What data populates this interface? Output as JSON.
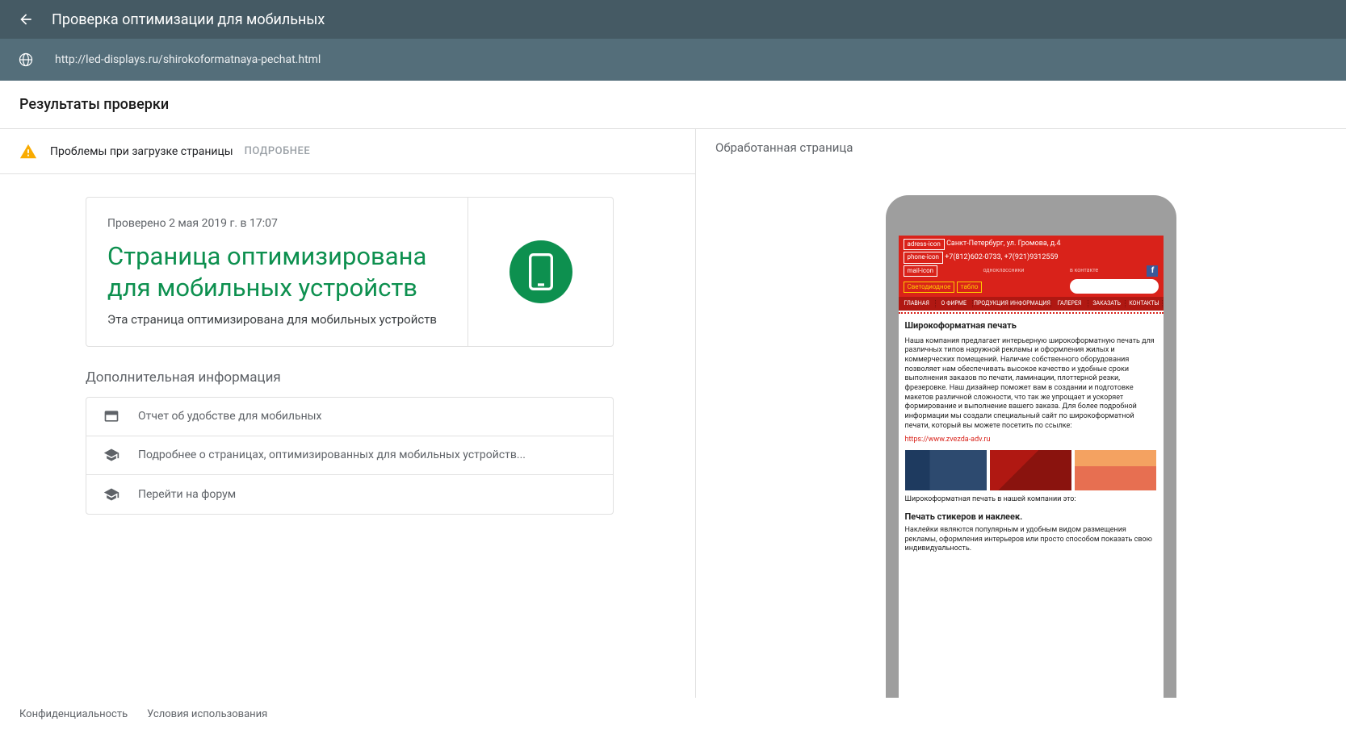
{
  "header": {
    "title": "Проверка оптимизации для мобильных",
    "url": "http://led-displays.ru/shirokoformatnaya-pechat.html"
  },
  "subheader": "Результаты проверки",
  "warning": {
    "text": "Проблемы при загрузке страницы",
    "link": "ПОДРОБНЕЕ"
  },
  "card": {
    "date": "Проверено 2 мая 2019 г. в 17:07",
    "heading": "Страница оптимизирована для мобильных устройств",
    "sub": "Эта страница оптимизирована для мобильных устройств"
  },
  "info": {
    "title": "Дополнительная информация",
    "items": [
      "Отчет об удобстве для мобильных",
      "Подробнее о страницах, оптимизированных для мобильных устройств...",
      "Перейти на форум"
    ]
  },
  "right": {
    "title": "Обработанная страница"
  },
  "preview": {
    "address_label": "adress-icon",
    "address": "Санкт-Петербург, ул. Громова, д.4",
    "phone_label": "phone-icon",
    "phone": "+7(812)602-0733, +7(921)9312559",
    "mail_label": "mail-icon",
    "social1": "одноклассники",
    "social2": "в контакте",
    "logo1": "Светодиодное",
    "logo2": "табло",
    "nav": [
      "ГЛАВНАЯ",
      "О ФИРМЕ",
      "ПРОДУКЦИЯ",
      "ИНФОРМАЦИЯ",
      "ГАЛЕРЕЯ",
      "ЗАКАЗАТЬ",
      "КОНТАКТЫ"
    ],
    "h1": "Широкоформатная печать",
    "body1": "Наша компания предлагает интерьерную широкоформатную печать для различных типов наружной рекламы и оформления жилых и коммерческих помещений. Наличие собственного оборудования позволяет нам обеспечивать высокое качество и удобные сроки выполнения заказов по печати, ламинации, плоттерной резки, фрезеровке. Наш дизайнер поможет вам в создании и подготовке макетов различной сложности, что так же упрощает и ускоряет формирование и выполнение вашего заказа. Для более подробной информации мы создали специальный сайт по широкоформатной печати, который вы можете посетить по ссылке:",
    "link": "https://www.zvezda-adv.ru",
    "body2": "Широкоформатная печать в нашей компании это:",
    "h2": "Печать стикеров и наклеек.",
    "body3": "Наклейки являются популярным и удобным видом размещения рекламы, оформления интерьеров или просто способом показать свою индивидуальность."
  },
  "footer": {
    "privacy": "Конфиденциальность",
    "terms": "Условия использования"
  }
}
